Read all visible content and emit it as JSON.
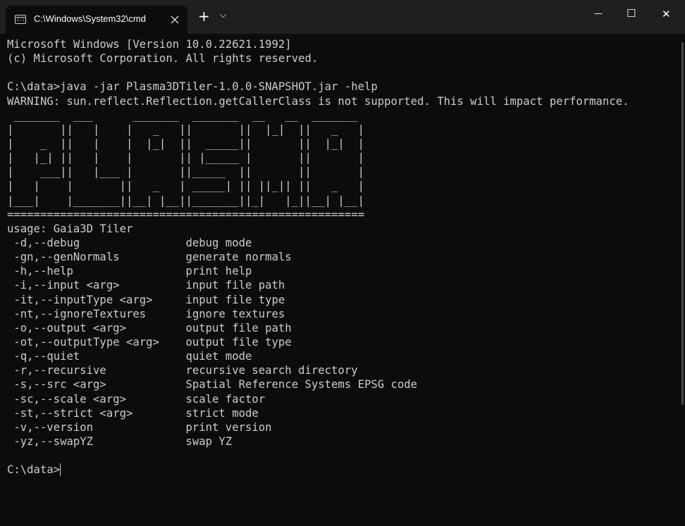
{
  "window": {
    "tab_title": "C:\\Windows\\System32\\cmd",
    "new_tab_glyph": "+",
    "dropdown_glyph": "⌵",
    "minimize_glyph": "—",
    "maximize_glyph": "☐",
    "close_glyph": "✕",
    "icons": [
      "terminal-icon",
      "close-icon",
      "plus-icon",
      "chevron-down-icon",
      "minimize-icon",
      "maximize-icon",
      "close-window-icon"
    ]
  },
  "terminal": {
    "lines": [
      "Microsoft Windows [Version 10.0.22621.1992]",
      "(c) Microsoft Corporation. All rights reserved.",
      "",
      "C:\\data>java -jar Plasma3DTiler-1.0.0-SNAPSHOT.jar -help",
      "WARNING: sun.reflect.Reflection.getCallerClass is not supported. This will impact performance.",
      " _______  ___      _______  _______  __   __  _______ ",
      "|       ||   |    |   _   ||       ||  |_|  ||   _   |",
      "|    _  ||   |    |  |_|  ||  _____||       ||  |_|  |",
      "|   |_| ||   |    |       || |_____ |       ||       |",
      "|    ___||   |___ |       ||_____  ||       ||       |",
      "|   |    |       ||   _   | _____| || ||_|| ||   _   |",
      "|___|    |_______||__| |__||_______||_|   |_||__| |__|",
      "======================================================",
      "usage: Gaia3D Tiler",
      " -d,--debug                debug mode",
      " -gn,--genNormals          generate normals",
      " -h,--help                 print help",
      " -i,--input <arg>          input file path",
      " -it,--inputType <arg>     input file type",
      " -nt,--ignoreTextures      ignore textures",
      " -o,--output <arg>         output file path",
      " -ot,--outputType <arg>    output file type",
      " -q,--quiet                quiet mode",
      " -r,--recursive            recursive search directory",
      " -s,--src <arg>            Spatial Reference Systems EPSG code",
      " -sc,--scale <arg>         scale factor",
      " -st,--strict <arg>        strict mode",
      " -v,--version              print version",
      " -yz,--swapYZ              swap YZ",
      ""
    ],
    "prompt": "C:\\data>",
    "input_value": ""
  }
}
